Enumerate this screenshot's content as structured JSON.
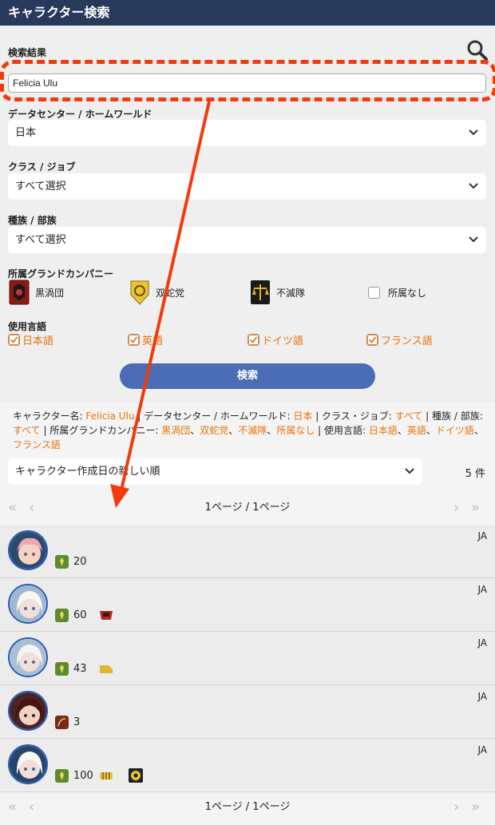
{
  "header": {
    "title": "キャラクター検索"
  },
  "search": {
    "results_label": "検索結果",
    "name_value": "Felicia Ulu",
    "dc_label": "データセンター / ホームワールド",
    "dc_value": "日本",
    "class_label": "クラス / ジョブ",
    "class_value": "すべて選択",
    "race_label": "種族 / 部族",
    "race_value": "すべて選択",
    "gc_label": "所属グランドカンパニー",
    "gc": [
      "黒渦団",
      "双蛇党",
      "不滅隊",
      "所属なし"
    ],
    "lang_label": "使用言語",
    "langs": [
      "日本語",
      "英語",
      "ドイツ語",
      "フランス語"
    ],
    "button": "検索"
  },
  "summary": {
    "k_name": "キャラクター名: ",
    "v_name": "Felicia Ulu",
    "k_dc": "データセンター / ホームワールド: ",
    "v_dc": "日本",
    "k_job": "クラス・ジョブ: ",
    "v_job": "すべて",
    "k_race": "種族 / 部族: ",
    "v_race": "すべて",
    "k_gc": "所属グランドカンパニー: ",
    "v_gc1": "黒渦団",
    "v_gc2": "双蛇党",
    "v_gc3": "不滅隊",
    "v_gc4": "所属なし",
    "k_lang": "使用言語: ",
    "v_lang1": "日本語",
    "v_lang2": "英語",
    "v_lang3": "ドイツ語",
    "v_lang4": "フランス語",
    "sep": " | ",
    "comma": "、"
  },
  "results": {
    "sort_value": "キャラクター作成日の新しい順",
    "count": "5 件",
    "pager": "1ページ / 1ページ",
    "rows": [
      {
        "lang": "JA",
        "level": "20"
      },
      {
        "lang": "JA",
        "level": "60"
      },
      {
        "lang": "JA",
        "level": "43"
      },
      {
        "lang": "JA",
        "level": "3"
      },
      {
        "lang": "JA",
        "level": "100"
      }
    ]
  },
  "colors": {
    "header": "#283a5c",
    "accent": "#e8730c",
    "button": "#4a6db6",
    "annotation": "#f23a0c"
  }
}
